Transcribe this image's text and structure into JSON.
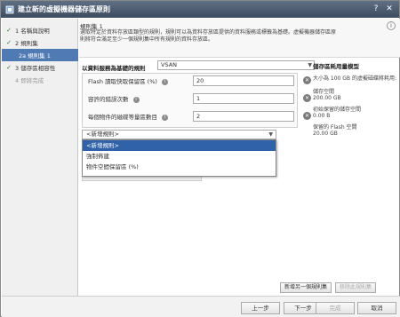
{
  "window": {
    "title": "建立新的虛擬機器儲存區原則",
    "icon": "policy-icon",
    "actions": [
      "help-icon",
      "close-icon"
    ]
  },
  "sidebar": {
    "items": [
      {
        "label": "1 名稱與說明",
        "state": "done"
      },
      {
        "label": "2 規則集",
        "state": "done"
      },
      {
        "label": "2a 規則集 1",
        "state": "active"
      },
      {
        "label": "3 儲存區相容性",
        "state": "done"
      },
      {
        "label": "4 即將完成",
        "state": "disabled"
      }
    ]
  },
  "header": {
    "title": "規則集 1",
    "description": "選取特定於資料存放區類型的規則，規則可以為資料存放區提供的資料服務或標籤為基礎。虛擬機器儲存區原則將符合滿足至少一個規則集中所有規則的資料存放區。",
    "help_icon": "info-icon"
  },
  "rules": {
    "label": "以資料服務為基礎的規則",
    "vendor_value": "VSAN",
    "items": [
      {
        "name": "Flash 讀取快取保留區 (%)",
        "value": "20"
      },
      {
        "name": "容許的錯誤次數",
        "value": "1"
      },
      {
        "name": "每個物件的磁碟等量區數目",
        "value": "2"
      }
    ],
    "add_rule_placeholder": "<新增規則>",
    "dropdown_options": [
      "<新增規則>",
      "強制佈建",
      "物件空間保留區 (%)"
    ],
    "selected_option": "<新增規則>"
  },
  "storage": {
    "title": "儲存區耗用量模型",
    "description": "大小為 100 GB 的虛擬磁碟將耗用:",
    "items": [
      {
        "label": "儲存空間",
        "value": "200.00 GB"
      },
      {
        "label": "初始保留的儲存空間",
        "value": "0.00 B"
      },
      {
        "label": "保留的 Flash 空間",
        "value": "20.00 GB"
      }
    ]
  },
  "actions": {
    "add_ruleset": "新增另一個規則集",
    "remove_ruleset": "移除此規則集"
  },
  "footer": {
    "back": "上一步",
    "next": "下一步",
    "finish": "完成",
    "cancel": "取消"
  }
}
